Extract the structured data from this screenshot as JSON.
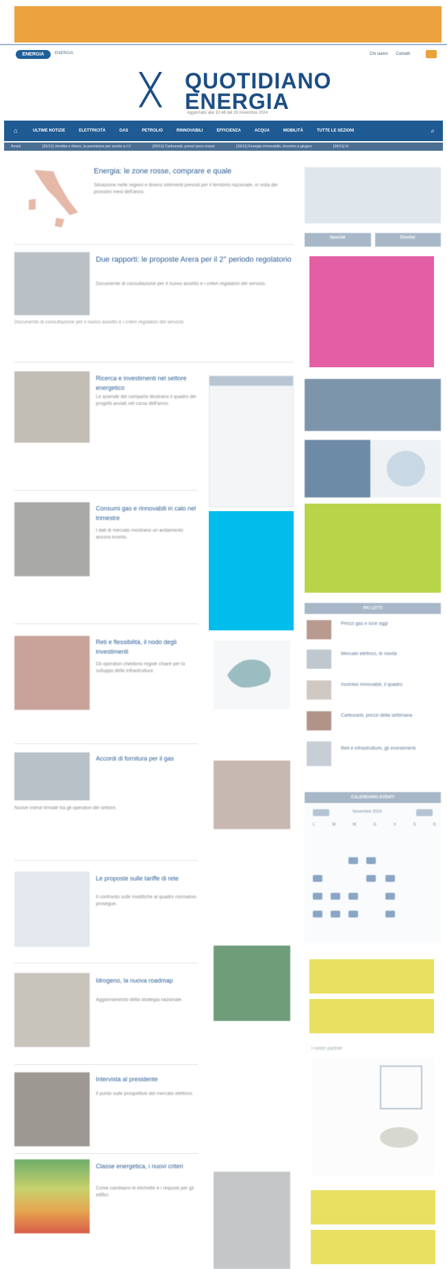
{
  "header": {
    "brand_small": "ENERGIA",
    "brand_pill": "ENERGIA",
    "util_links": [
      "Chi siamo",
      "Contatti"
    ],
    "logo_line1": "QUOTIDIANO",
    "logo_line2": "ENERGIA",
    "logo_tagline": "Aggiornato alle 10:48 del 26 novembre 2024"
  },
  "nav": {
    "home_icon": "home-icon",
    "items": [
      "ULTIME NOTIZIE",
      "ELETTRICITÀ",
      "GAS",
      "PETROLIO",
      "RINNOVABILI",
      "EFFICIENZA",
      "ACQUA",
      "MOBILITÀ",
      "TUTTE LE SEZIONI"
    ],
    "search_icon": "search-icon"
  },
  "ticker": {
    "items": [
      "Avvisi",
      "[26/11] Vendita e rilievo, la previsione per anche a I.V",
      "[26/11] Carburanti, prezzi poco mossi",
      "[26/11] Energia rinnovabile, incontro a giugno",
      "[26/11] N"
    ]
  },
  "main": {
    "articles": [
      {
        "title": "Energia: le zone rosse, comprare e quale",
        "text": "Situazione nelle regioni e diversi interventi previsti per il territorio nazionale, in vista dei prossimi mesi dell'anno."
      },
      {
        "title": "Due rapporti: le proposte Arera per il 2° periodo regolatorio",
        "text": "Documento di consultazione per il nuovo assetto e i criteri regolatori del servizio."
      },
      {
        "title": "Ricerca e investimenti nel settore energetico",
        "text": "Le aziende del comparto illustrano il quadro dei progetti avviati nel corso dell'anno."
      },
      {
        "title": "Consumi gas e rinnovabili in calo nel trimestre",
        "text": "I dati di mercato mostrano un andamento ancora incerto."
      },
      {
        "title": "Reti e flessibilità, il nodo degli investimenti",
        "text": "Gli operatori chiedono regole chiare per lo sviluppo delle infrastrutture."
      },
      {
        "title": "Accordi di fornitura per il gas",
        "text": "Nuove intese firmate tra gli operatori del settore."
      },
      {
        "title": "Le proposte sulle tariffe di rete",
        "text": "Il confronto sulle modifiche al quadro normativo prosegue."
      },
      {
        "title": "Idrogeno, la nuova roadmap",
        "text": "Aggiornamento della strategia nazionale."
      },
      {
        "title": "Intervista al presidente",
        "text": "Il punto sulle prospettive del mercato elettrico."
      },
      {
        "title": "Classe energetica, i nuovi criteri",
        "text": "Come cambiano le etichette e i requisiti per gli edifici."
      }
    ]
  },
  "sidebar": {
    "sections": [
      "Speciali",
      "Dossier"
    ],
    "most_read_title": "PIÙ LETTI",
    "most_read": [
      "Prezzi gas e luce oggi",
      "Mercato elettrico, le novità",
      "Incentivi rinnovabili, il quadro",
      "Carburanti, prezzi della settimana",
      "Reti e infrastrutture, gli investimenti"
    ],
    "calendar_title": "CALENDARIO EVENTI",
    "calendar_month": "Novembre 2024",
    "weekdays": [
      "L",
      "M",
      "M",
      "G",
      "V",
      "S",
      "D"
    ],
    "partners_title": "I nostri partner"
  },
  "colors": {
    "banner_orange": "#eca23e",
    "nav_blue": "#1f5a92",
    "ad_magenta": "#e35ea4",
    "ad_cyan": "#00bdec",
    "ad_green": "#b8d54a",
    "ad_yellow": "#e9e061"
  }
}
